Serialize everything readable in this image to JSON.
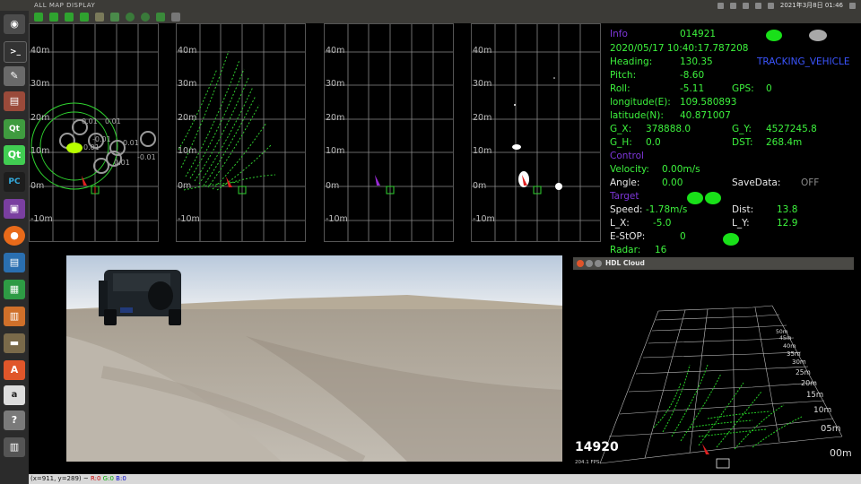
{
  "app": {
    "title": "ALL MAP DISPLAY"
  },
  "system": {
    "datetime": "2021年3月8日 01:46"
  },
  "radar_panels": [
    {
      "id": "fused",
      "y_labels": [
        "40m",
        "30m",
        "20m",
        "10m",
        "0m",
        "-10m"
      ]
    },
    {
      "id": "lidar",
      "y_labels": [
        "40m",
        "30m",
        "20m",
        "10m",
        "0m",
        "-10m"
      ]
    },
    {
      "id": "radar",
      "y_labels": [
        "40m",
        "30m",
        "20m",
        "10m",
        "0m",
        "-10m"
      ]
    },
    {
      "id": "vision",
      "y_labels": [
        "40m",
        "30m",
        "20m",
        "10m",
        "0m",
        "-10m"
      ]
    }
  ],
  "fused_labels": [
    "0.01",
    "0.01",
    "0.01",
    "-0.01",
    "-0.01",
    "0.01",
    "0.01"
  ],
  "info": {
    "info_label": "Info",
    "frame": "014921",
    "timestamp": "2020/05/17 10:40:17.787208",
    "heading_label": "Heading:",
    "heading": "130.35",
    "mode": "TRACKING_VEHICLE",
    "pitch_label": "Pitch:",
    "pitch": "-8.60",
    "roll_label": "Roll:",
    "roll": "-5.11",
    "gps_label": "GPS:",
    "gps": "0",
    "longitude_label": "longitude(E):",
    "longitude": "109.580893",
    "latitude_label": "latitude(N):",
    "latitude": "40.871007",
    "gx_label": "G_X:",
    "gx": "378888.0",
    "gy_label": "G_Y:",
    "gy": "4527245.8",
    "gh_label": "G_H:",
    "gh": "0.0",
    "dst_label": "DST:",
    "dst": "268.4m",
    "control_label": "Control",
    "velocity_label": "Velocity:",
    "velocity": "0.00m/s",
    "angle_label": "Angle:",
    "angle": "0.00",
    "savedata_label": "SaveData:",
    "savedata": "OFF",
    "target_label": "Target",
    "speed_label": "Speed:",
    "speed": "-1.78m/s",
    "dist_label": "Dist:",
    "dist": "13.8",
    "lx_label": "L_X:",
    "lx": "-5.0",
    "ly_label": "L_Y:",
    "ly": "12.9",
    "estop_label": "E-StOP:",
    "estop": "0",
    "radar_label": "Radar:",
    "radar": "16"
  },
  "hdl": {
    "window_title": "HDL Cloud",
    "frame": "14920",
    "fps": "204.1 FPS",
    "ranges": [
      "50m",
      "45m",
      "40m",
      "35m",
      "30m",
      "25m",
      "20m",
      "15m",
      "10m",
      "05m",
      "00m"
    ]
  },
  "status": {
    "text": "(x=911, y=289) ~ ",
    "r": "R:0",
    "g": "G:0",
    "b": "B:0"
  },
  "colors": {
    "green": "#3df23d",
    "purple": "#7d36d8",
    "blue": "#3b55ff",
    "grid": "#8a8a8a"
  }
}
